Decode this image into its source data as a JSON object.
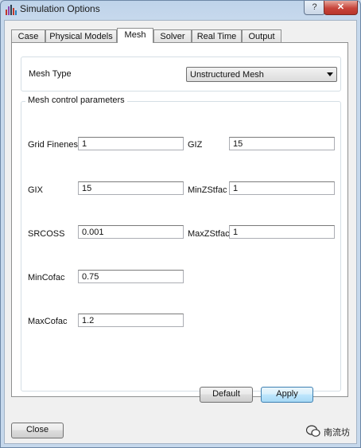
{
  "window": {
    "title": "Simulation Options",
    "help_label": "?",
    "close_label": "✕"
  },
  "tabs": [
    {
      "label": "Case"
    },
    {
      "label": "Physical Models"
    },
    {
      "label": "Mesh"
    },
    {
      "label": "Solver"
    },
    {
      "label": "Real Time"
    },
    {
      "label": "Output"
    }
  ],
  "active_tab": "Mesh",
  "mesh_type": {
    "label": "Mesh Type",
    "value": "Unstructured Mesh"
  },
  "mesh_control": {
    "title": "Mesh control parameters",
    "grid_fineness": {
      "label": "Grid Fineness",
      "value": "1"
    },
    "giz": {
      "label": "GIZ",
      "value": "15"
    },
    "gix": {
      "label": "GIX",
      "value": "15"
    },
    "minzstfac": {
      "label": "MinZStfac",
      "value": "1"
    },
    "srcoss": {
      "label": "SRCOSS",
      "value": "0.001"
    },
    "maxzstfac": {
      "label": "MaxZStfac",
      "value": "1"
    },
    "mincofac": {
      "label": "MinCofac",
      "value": "0.75"
    },
    "maxcofac": {
      "label": "MaxCofac",
      "value": "1.2"
    }
  },
  "buttons": {
    "default": "Default",
    "apply": "Apply",
    "close": "Close"
  },
  "watermark": {
    "text": "南流坊"
  },
  "colors": {
    "accent": "#3c7fb1",
    "titlebar": "#c6d8ec",
    "close": "#c7443a"
  }
}
